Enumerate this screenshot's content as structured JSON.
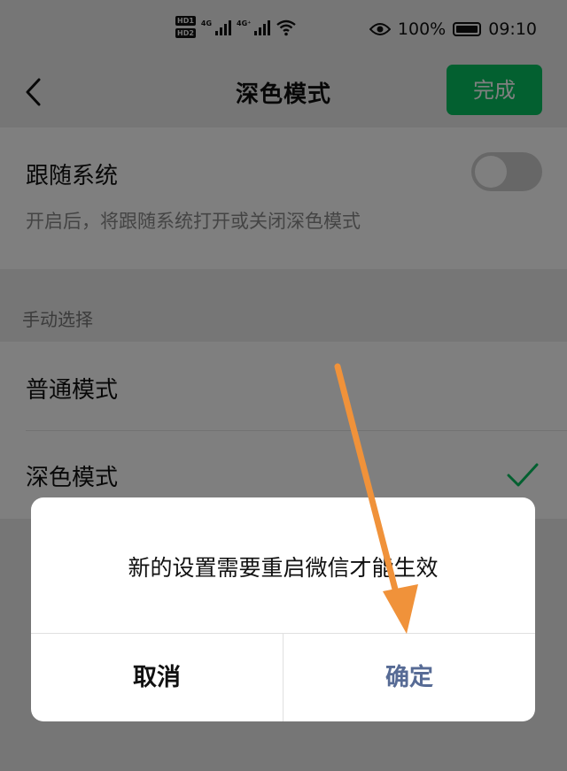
{
  "status_bar": {
    "hd_badges": [
      "HD1",
      "HD2"
    ],
    "network_1": "4G",
    "network_2": "4G⁺",
    "battery_percent": "100%",
    "time": "09:10"
  },
  "nav": {
    "title": "深色模式",
    "done_label": "完成"
  },
  "follow_system": {
    "label": "跟随系统",
    "description": "开启后，将跟随系统打开或关闭深色模式",
    "enabled": false
  },
  "manual": {
    "header": "手动选择",
    "options": [
      {
        "label": "普通模式",
        "selected": false
      },
      {
        "label": "深色模式",
        "selected": true
      }
    ]
  },
  "dialog": {
    "message": "新的设置需要重启微信才能生效",
    "cancel_label": "取消",
    "confirm_label": "确定"
  },
  "colors": {
    "accent_green": "#07c160",
    "confirm_blue": "#576b95",
    "annotation_arrow": "#f0923a"
  }
}
